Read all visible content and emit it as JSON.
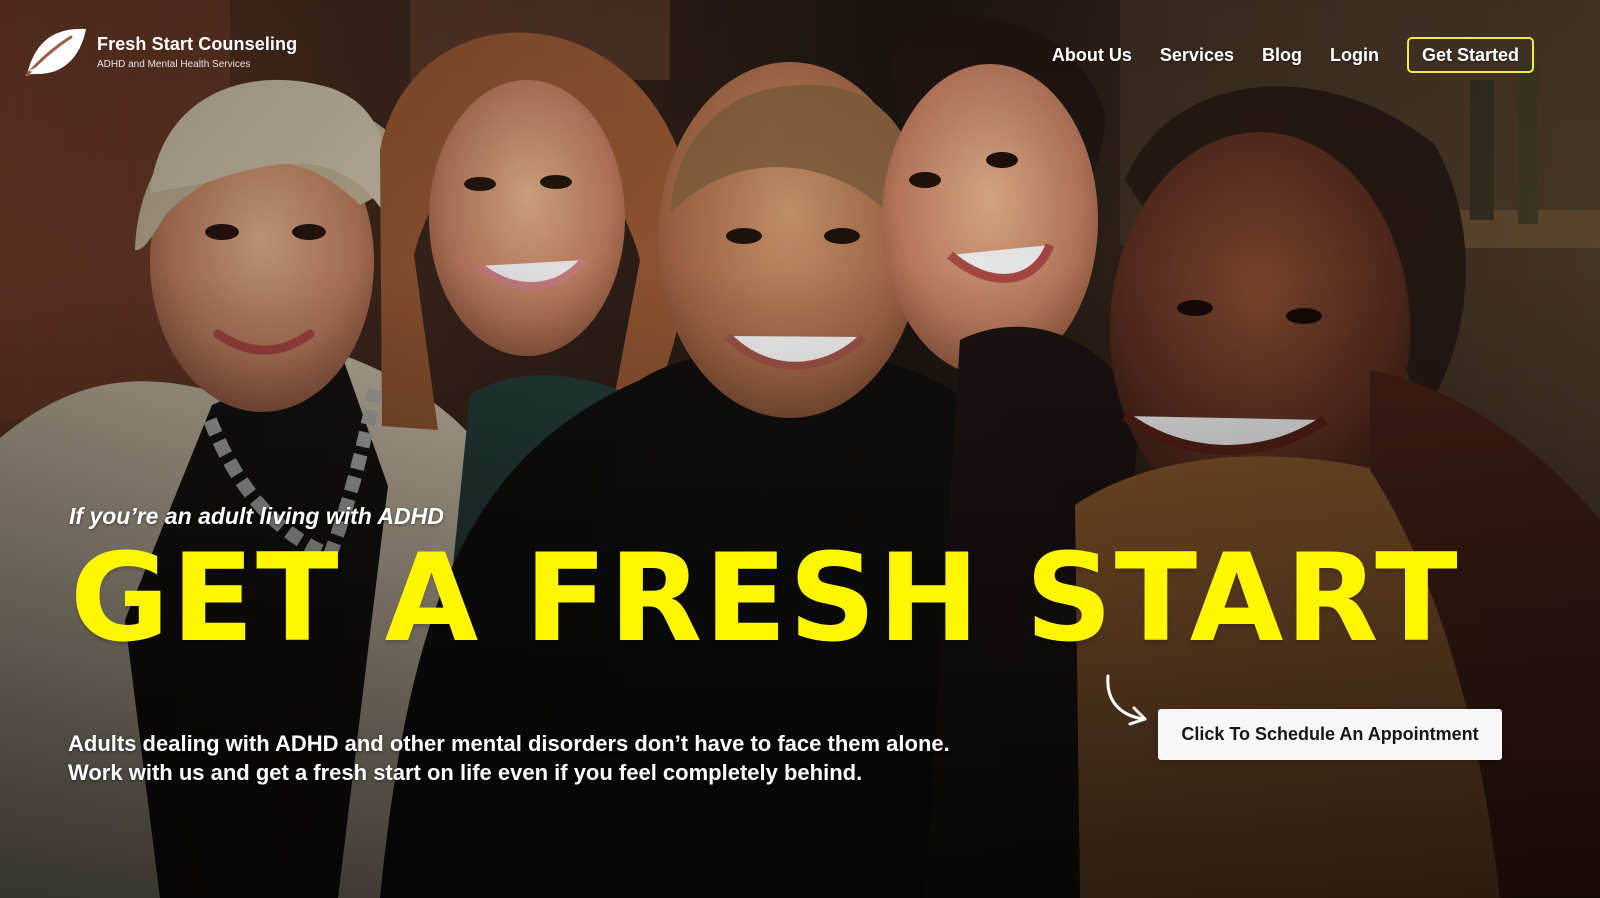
{
  "site": {
    "brand": "Fresh Start Counseling",
    "tagline": "ADHD and Mental Health Services"
  },
  "navigation": {
    "items": [
      {
        "label": "About Us"
      },
      {
        "label": "Services"
      },
      {
        "label": "Blog"
      },
      {
        "label": "Login"
      }
    ],
    "cta_label": "Get Started"
  },
  "hero": {
    "eyebrow": "If you’re an adult living with ADHD",
    "headline": "GET A FRESH START",
    "description_line_1": "Adults dealing with ADHD and other mental disorders don’t have to face them alone.",
    "description_line_2": "Work with us and get a fresh start on life even if you feel completely behind.",
    "button_label": "Click To Schedule An Appointment"
  },
  "visuals": {
    "headline_color": "#FFF600",
    "cta_outline_color": "#F4E84A",
    "button_background": "#F7F7F7",
    "hero_image": "group-of-five-smiling-adults",
    "icons": [
      "leaf-logo-icon",
      "curved-arrow-icon"
    ]
  }
}
